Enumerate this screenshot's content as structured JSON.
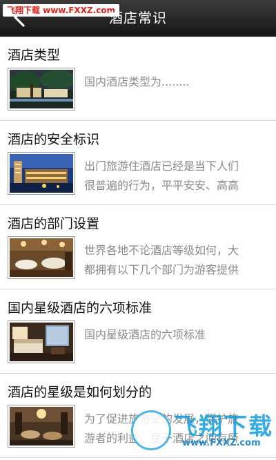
{
  "header": {
    "watermark": "飞翔下载 www.FXXZ.com",
    "title": "酒店常识",
    "back_icon": "back-arrow-icon"
  },
  "articles": [
    {
      "title": "酒店类型",
      "lines": [
        "国内酒店类型为........"
      ],
      "thumb": "hotel-lobby-photo"
    },
    {
      "title": "酒店的安全标识",
      "lines": [
        "出门旅游住酒店已经是当下人们",
        "很普遍的行为，平平安安、高高"
      ],
      "thumb": "hotel-night-exterior-photo"
    },
    {
      "title": "酒店的部门设置",
      "lines": [
        "世界各地不论酒店等级如何，大",
        "都拥有以下几个部门为游客提供"
      ],
      "thumb": "hotel-restaurant-photo"
    },
    {
      "title": "国内星级酒店的六项标准",
      "lines": [
        "国内星级酒店的六项标准"
      ],
      "thumb": "hotel-room-photo"
    },
    {
      "title": "酒店的星级是如何划分的",
      "lines": [
        "为了促进旅游业的发展，保护旅",
        "游者的利益，便于酒店之间有所"
      ],
      "thumb": "hotel-lounge-photo"
    }
  ],
  "watermark_bottom": {
    "text": "飞翔下载",
    "url": "www.FXXZ.com"
  }
}
